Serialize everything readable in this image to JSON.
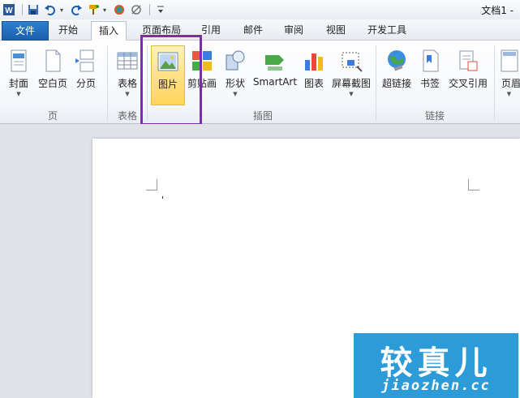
{
  "window": {
    "title": "文档1 -"
  },
  "qat": {
    "app_icon": "word-icon",
    "items": [
      "save-icon",
      "undo-icon",
      "redo-icon",
      "format-painter-icon",
      "color-icon",
      "clear-format-icon",
      "customize-icon"
    ]
  },
  "tabs": [
    {
      "label": "文件"
    },
    {
      "label": "开始"
    },
    {
      "label": "插入"
    },
    {
      "label": "页面布局"
    },
    {
      "label": "引用"
    },
    {
      "label": "邮件"
    },
    {
      "label": "审阅"
    },
    {
      "label": "视图"
    },
    {
      "label": "开发工具"
    }
  ],
  "ribbon": {
    "buttons": {
      "cover": "封面",
      "blank": "空白页",
      "pagebreak": "分页",
      "table": "表格",
      "picture": "图片",
      "clipart": "剪贴画",
      "shapes": "形状",
      "smartart": "SmartArt",
      "chart": "图表",
      "screenshot": "屏幕截图",
      "hyperlink": "超链接",
      "bookmark": "书签",
      "crossref": "交叉引用",
      "header": "页眉"
    },
    "groups": {
      "pages": "页",
      "tables": "表格",
      "illustrations": "插图",
      "links": "链接"
    }
  },
  "watermark": {
    "cn": "较真儿",
    "en": "jiaozhen.cc"
  },
  "colors": {
    "file_tab": "#1b5fad",
    "highlight": "#7b2ea8",
    "watermark_bg": "#2e9bd9"
  }
}
